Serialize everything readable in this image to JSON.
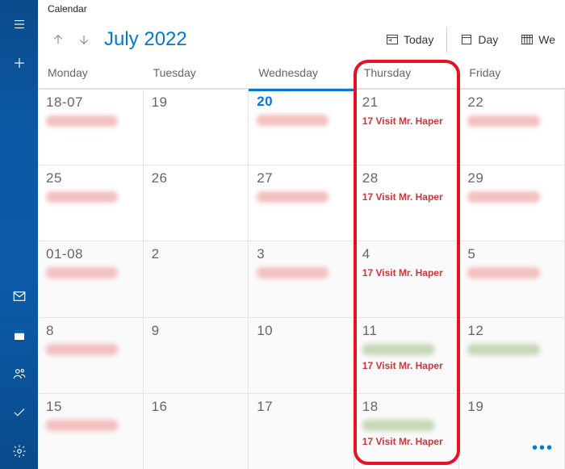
{
  "app_title": "Calendar",
  "header": {
    "month_label": "July 2022",
    "today_btn": "Today",
    "day_btn": "Day",
    "week_btn": "We"
  },
  "day_headers": [
    "Monday",
    "Tuesday",
    "Wednesday",
    "Thursday",
    "Friday"
  ],
  "rows": [
    {
      "cells": [
        {
          "date": "18-07",
          "blurred": true
        },
        {
          "date": "19"
        },
        {
          "date": "20",
          "today": true,
          "blurred": true
        },
        {
          "date": "21",
          "events": [
            "17 Visit Mr. Haper"
          ]
        },
        {
          "date": "22",
          "blurred": true
        }
      ]
    },
    {
      "cells": [
        {
          "date": "25",
          "blurred": true
        },
        {
          "date": "26"
        },
        {
          "date": "27",
          "blurred": true
        },
        {
          "date": "28",
          "events": [
            "17 Visit Mr. Haper"
          ]
        },
        {
          "date": "29",
          "blurred": true
        }
      ]
    },
    {
      "alt": true,
      "cells": [
        {
          "date": "01-08",
          "blurred": true
        },
        {
          "date": "2"
        },
        {
          "date": "3",
          "blurred": true
        },
        {
          "date": "4",
          "events": [
            "17 Visit Mr. Haper"
          ]
        },
        {
          "date": "5",
          "blurred": true
        }
      ]
    },
    {
      "alt": true,
      "cells": [
        {
          "date": "8",
          "blurred": true
        },
        {
          "date": "9"
        },
        {
          "date": "10"
        },
        {
          "date": "11",
          "blurred_b2": true,
          "events": [
            "17 Visit Mr. Haper"
          ]
        },
        {
          "date": "12",
          "blurred_b2": true
        }
      ]
    },
    {
      "alt": true,
      "cells": [
        {
          "date": "15",
          "blurred": true
        },
        {
          "date": "16"
        },
        {
          "date": "17"
        },
        {
          "date": "18",
          "blurred_b2": true,
          "events": [
            "17 Visit Mr. Haper"
          ]
        },
        {
          "date": "19"
        }
      ]
    }
  ],
  "more_label": "•••"
}
